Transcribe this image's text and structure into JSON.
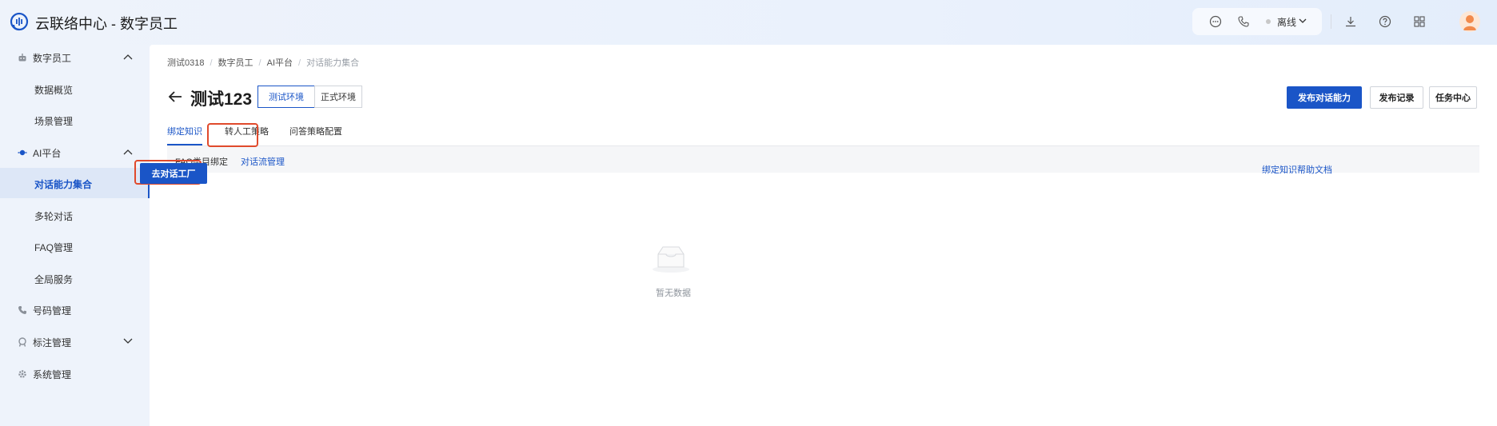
{
  "header": {
    "app_title": "云联络中心 - 数字员工",
    "status_label": "离线",
    "icons": [
      "chat-icon",
      "phone-icon",
      "download-icon",
      "help-icon",
      "apps-grid-icon"
    ]
  },
  "sidebar": {
    "items": [
      {
        "label": "数字员工",
        "icon": "robot-icon",
        "expanded": true
      },
      {
        "label": "数据概览"
      },
      {
        "label": "场景管理"
      },
      {
        "label": "AI平台",
        "icon": "ai-icon",
        "expanded": true
      },
      {
        "label": "对话能力集合",
        "active": true
      },
      {
        "label": "多轮对话"
      },
      {
        "label": "FAQ管理"
      },
      {
        "label": "全局服务"
      },
      {
        "label": "号码管理",
        "icon": "phone-icon"
      },
      {
        "label": "标注管理",
        "icon": "tag-icon",
        "expanded": false
      },
      {
        "label": "系统管理",
        "icon": "gear-icon"
      }
    ]
  },
  "breadcrumb": [
    "测试0318",
    "数字员工",
    "AI平台",
    "对话能力集合"
  ],
  "page": {
    "title": "测试123",
    "env_tabs": [
      "测试环境",
      "正式环境"
    ],
    "actions": {
      "publish": "发布对话能力",
      "history": "发布记录",
      "tasks": "任务中心"
    }
  },
  "tabs": [
    "绑定知识",
    "转人工策略",
    "问答策略配置"
  ],
  "subtabs": [
    "FAQ类目绑定",
    "对话流管理"
  ],
  "factory_button": "去对话工厂",
  "help_link": "绑定知识帮助文档",
  "empty_text": "暂无数据",
  "colors": {
    "accent": "#1a55c7",
    "highlight": "#e04a2c",
    "sidebar_bg": "#eef3fb"
  }
}
